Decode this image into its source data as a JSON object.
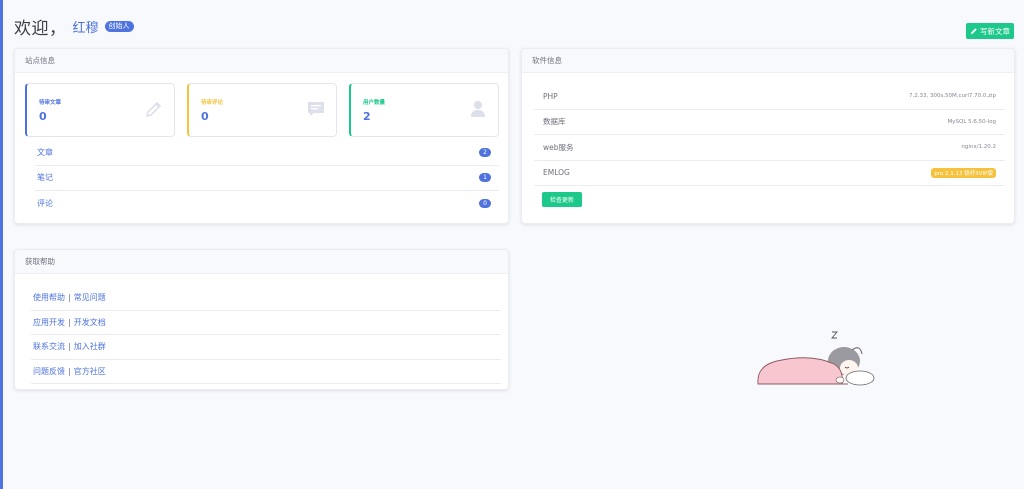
{
  "header": {
    "welcome": "欢迎，",
    "username": "红穆",
    "role_badge": "创始人",
    "write_button": "写新文章"
  },
  "site_info": {
    "title": "站点信息",
    "stats": [
      {
        "label": "待审文章",
        "value": "0",
        "icon": "pencil-icon",
        "color": "#4e73df"
      },
      {
        "label": "待审评论",
        "value": "0",
        "icon": "comment-icon",
        "color": "#f6c23e"
      },
      {
        "label": "用户数量",
        "value": "2",
        "icon": "user-icon",
        "color": "#1cc88a"
      }
    ],
    "items": [
      {
        "label": "文章",
        "count": "2"
      },
      {
        "label": "笔记",
        "count": "1"
      },
      {
        "label": "评论",
        "count": "0"
      }
    ]
  },
  "software_info": {
    "title": "软件信息",
    "rows": [
      {
        "key": "PHP",
        "value": "7.2.33, 300s,50M,curl7.70.0,zip"
      },
      {
        "key": "数据库",
        "value": "MySQL 5.6.50-log"
      },
      {
        "key": "web服务",
        "value": "nginx/1.20.2"
      },
      {
        "key": "EMLOG",
        "value": "pro 2.1.13 铁杆SVIP版"
      }
    ],
    "check_button": "检查更新"
  },
  "help": {
    "title": "获取帮助",
    "rows": [
      {
        "a": "使用帮助",
        "sep": "|",
        "b": "常见问题"
      },
      {
        "a": "应用开发",
        "sep": "|",
        "b": "开发文档"
      },
      {
        "a": "联系交流",
        "sep": "|",
        "b": "加入社群"
      },
      {
        "a": "问题反馈",
        "sep": "|",
        "b": "官方社区"
      }
    ]
  },
  "colors": {
    "primary": "#4e73df",
    "success": "#1cc88a",
    "warning": "#f6c23e",
    "background": "#f8f9fc"
  }
}
